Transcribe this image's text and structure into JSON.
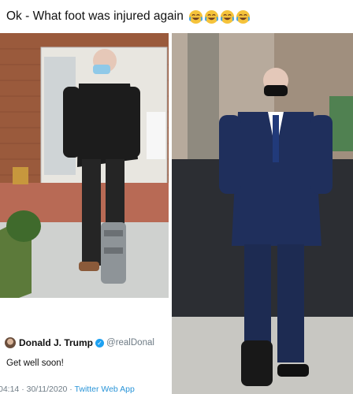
{
  "caption": {
    "text": "Ok - What foot was injured again",
    "emojis": [
      "face-with-tears-of-joy-icon",
      "face-with-tears-of-joy-icon",
      "face-with-tears-of-joy-icon",
      "face-with-tears-of-joy-icon"
    ]
  },
  "tweet": {
    "name": "Donald J. Trump",
    "verified_icon": "verified-badge-icon",
    "handle": "@realDonal",
    "text": "Get well soon!",
    "time": "04:14 · 30/11/2020 · ",
    "source": "Twitter Web App"
  },
  "colors": {
    "verified": "#1da1f2",
    "meta_gray": "#6e7b85",
    "source_blue": "#2a95d8"
  }
}
